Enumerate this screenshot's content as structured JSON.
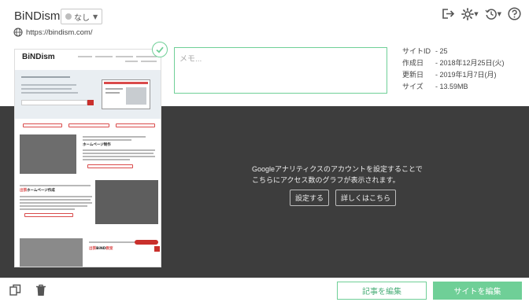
{
  "header": {
    "site_name": "BiNDism",
    "status": "なし",
    "url": "https://bindism.com/"
  },
  "memo": {
    "placeholder": "メモ..."
  },
  "meta": [
    {
      "key": "サイトID",
      "value": "- 25"
    },
    {
      "key": "作成日",
      "value": "- 2018年12月25日(火)"
    },
    {
      "key": "更新日",
      "value": "- 2019年1月7日(月)"
    },
    {
      "key": "サイズ",
      "value": "- 13.59MB"
    }
  ],
  "analytics": {
    "line1": "Googleアナリティクスのアカウントを設定することで",
    "line2": "こちらにアクセス数のグラフが表示されます。",
    "setup_label": "設定する",
    "details_label": "詳しくはこちら"
  },
  "thumbnail": {
    "logo": "BiNDism",
    "section1_title": "ホームページ制作",
    "section2_prefix": "出張",
    "section2_title": "ホームページ作成",
    "section3_prefix": "出張",
    "section3_title": "BiND",
    "section3_suffix": "教室"
  },
  "footer": {
    "edit_article_label": "記事を編集",
    "edit_site_label": "サイトを編集"
  },
  "colors": {
    "accent": "#6fcf97",
    "dark_panel": "#3d3d3d",
    "brand_red": "#d94b4b"
  },
  "icons": [
    "globe-icon",
    "logout-icon",
    "gear-icon",
    "history-icon",
    "help-icon",
    "check-icon",
    "duplicate-icon",
    "trash-icon"
  ]
}
